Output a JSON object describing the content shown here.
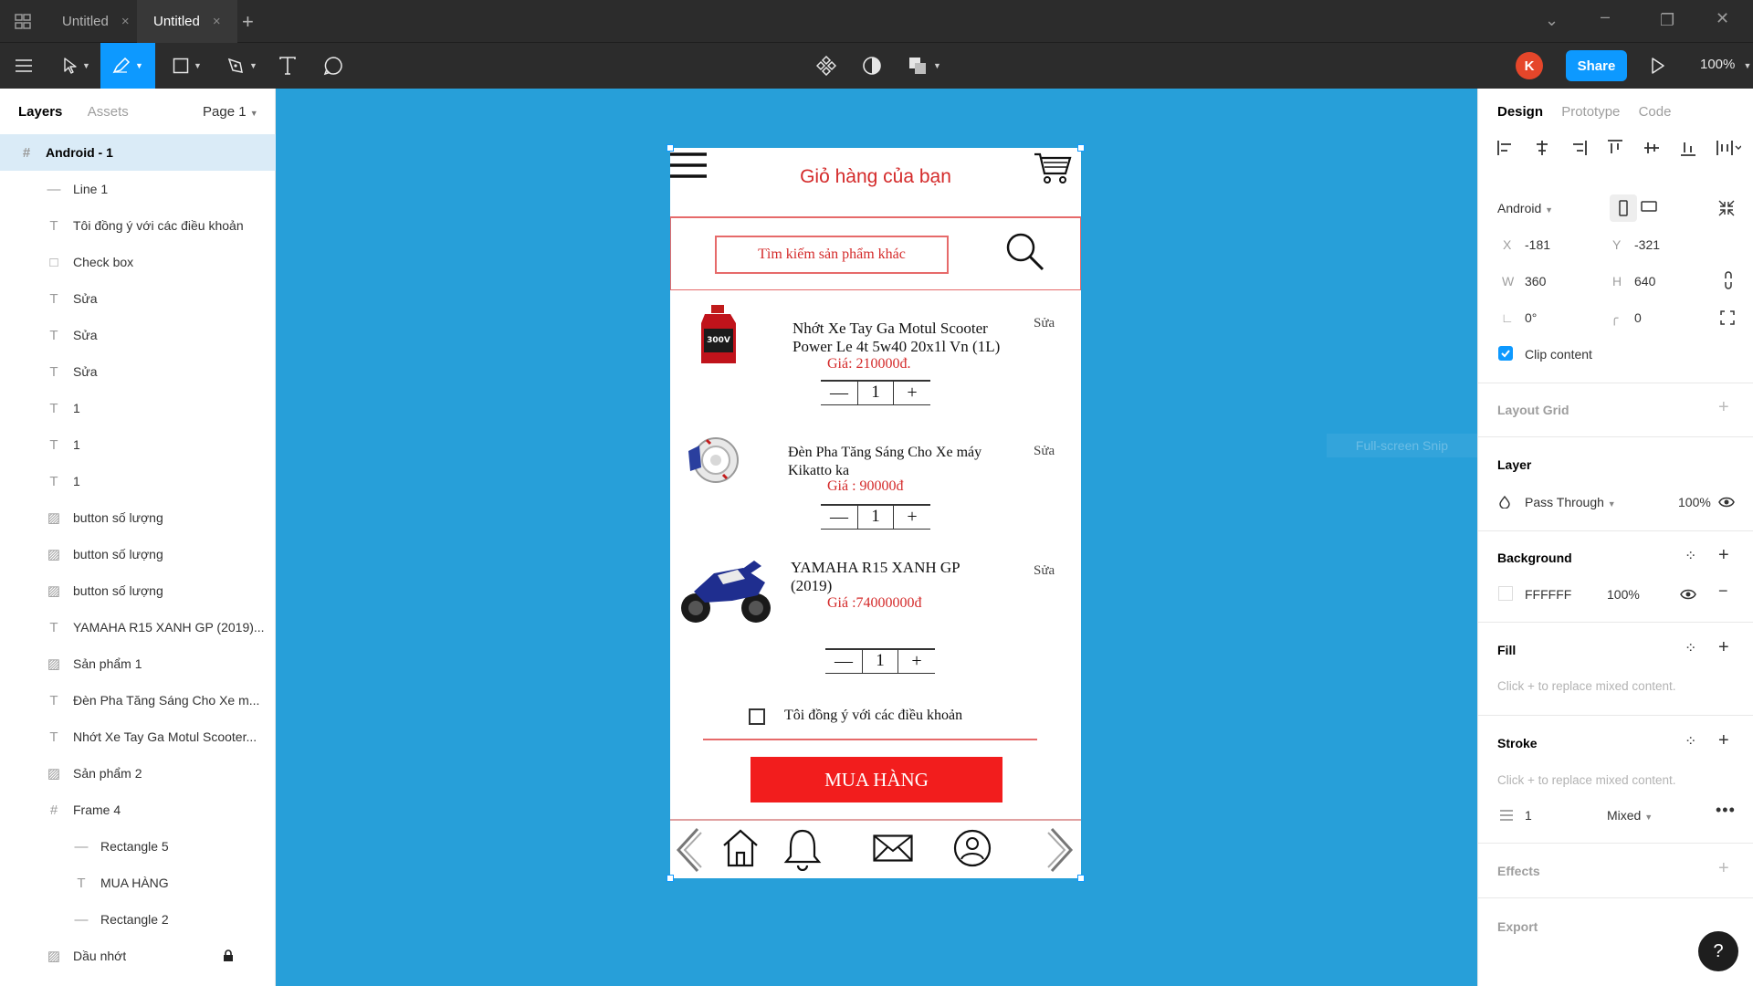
{
  "titlebar": {
    "tabs": [
      {
        "label": "Untitled",
        "active": false
      },
      {
        "label": "Untitled",
        "active": true
      }
    ]
  },
  "toolbar": {
    "avatar_initial": "K",
    "share_label": "Share",
    "zoom": "100%"
  },
  "left_panel": {
    "tab_layers": "Layers",
    "tab_assets": "Assets",
    "page": "Page 1",
    "layers": [
      {
        "name": "Android - 1",
        "type": "frame",
        "depth": 0,
        "selected": true
      },
      {
        "name": "Line 1",
        "type": "line",
        "depth": 1
      },
      {
        "name": "Tôi đồng ý với các điều khoản",
        "type": "text",
        "depth": 1
      },
      {
        "name": "Check box",
        "type": "rect",
        "depth": 1
      },
      {
        "name": "Sửa",
        "type": "text",
        "depth": 1
      },
      {
        "name": "Sửa",
        "type": "text",
        "depth": 1
      },
      {
        "name": "Sửa",
        "type": "text",
        "depth": 1
      },
      {
        "name": "1",
        "type": "text",
        "depth": 1
      },
      {
        "name": "1",
        "type": "text",
        "depth": 1
      },
      {
        "name": "1",
        "type": "text",
        "depth": 1
      },
      {
        "name": "button số lượng",
        "type": "image",
        "depth": 1
      },
      {
        "name": "button số lượng",
        "type": "image",
        "depth": 1
      },
      {
        "name": "button số lượng",
        "type": "image",
        "depth": 1
      },
      {
        "name": "YAMAHA R15 XANH GP (2019)...",
        "type": "text",
        "depth": 1
      },
      {
        "name": "Sản phẩm 1",
        "type": "image",
        "depth": 1
      },
      {
        "name": "Đèn Pha Tăng Sáng Cho Xe m...",
        "type": "text",
        "depth": 1
      },
      {
        "name": "Nhớt Xe Tay Ga Motul Scooter...",
        "type": "text",
        "depth": 1
      },
      {
        "name": "Sản phẩm 2",
        "type": "image",
        "depth": 1
      },
      {
        "name": "Frame 4",
        "type": "frame",
        "depth": 1
      },
      {
        "name": "Rectangle 5",
        "type": "line",
        "depth": 2
      },
      {
        "name": "MUA HÀNG",
        "type": "text",
        "depth": 2
      },
      {
        "name": "Rectangle 2",
        "type": "line",
        "depth": 2
      },
      {
        "name": "Dầu nhớt",
        "type": "image",
        "depth": 1,
        "locked": true
      }
    ]
  },
  "canvas": {
    "snip_label": "Full-screen Snip"
  },
  "phone": {
    "title": "Giỏ hàng của bạn",
    "search_placeholder": "Tìm kiếm sản phẩm khác",
    "products": [
      {
        "name_line1": "Nhớt Xe Tay Ga Motul Scooter",
        "name_line2": "Power Le 4t 5w40 20x1l Vn (1L)",
        "price": "Giá:  210000đ.",
        "edit": "Sửa",
        "qty": "1"
      },
      {
        "name_line1": "Đèn Pha Tăng Sáng Cho Xe máy",
        "name_line2": "Kikatto ka",
        "price": "Giá : 90000đ",
        "edit": "Sửa",
        "qty": "1"
      },
      {
        "name_line1": "YAMAHA R15 XANH GP",
        "name_line2": "(2019)",
        "price": "Giá :74000000đ",
        "edit": "Sửa",
        "qty": "1"
      }
    ],
    "agree_text": "Tôi đồng ý với  các điều khoản",
    "buy_label": "MUA HÀNG"
  },
  "right_panel": {
    "tabs": {
      "design": "Design",
      "prototype": "Prototype",
      "code": "Code"
    },
    "frame_preset": "Android",
    "x_label": "X",
    "x_value": "-181",
    "y_label": "Y",
    "y_value": "-321",
    "w_label": "W",
    "w_value": "360",
    "h_label": "H",
    "h_value": "640",
    "rotation": "0°",
    "radius": "0",
    "clip_content": "Clip content",
    "layout_grid": "Layout Grid",
    "layer_title": "Layer",
    "blend_mode": "Pass Through",
    "layer_opacity": "100%",
    "background_title": "Background",
    "bg_hex": "FFFFFF",
    "bg_opacity": "100%",
    "fill_title": "Fill",
    "fill_hint": "Click + to replace mixed content.",
    "stroke_title": "Stroke",
    "stroke_hint": "Click + to replace mixed content.",
    "stroke_weight": "1",
    "stroke_mode": "Mixed",
    "effects_title": "Effects",
    "export_title": "Export",
    "help_label": "?"
  },
  "colors": {
    "accent": "#0d99ff",
    "canvas": "#279fd9",
    "brand_red": "#f21d1d",
    "avatar": "#e5462a"
  }
}
